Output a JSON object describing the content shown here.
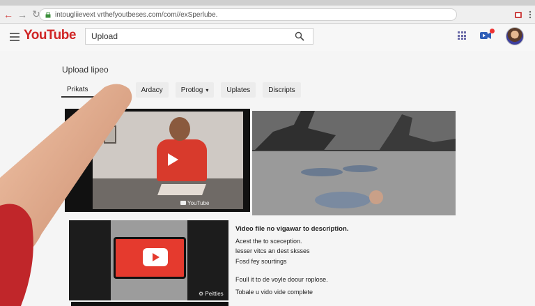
{
  "browser": {
    "url": "intougliievext vrthefyoutbeses.com/com//exSperlube."
  },
  "youtube": {
    "logo": "YouTube",
    "search_value": "Upload"
  },
  "page": {
    "title": "Upload lipeo",
    "tabs": [
      {
        "label": "Prikats",
        "active": true
      },
      {
        "label": "Ardacy"
      },
      {
        "label": "Protlog"
      },
      {
        "label": "Uplates"
      },
      {
        "label": "Discripts"
      }
    ]
  },
  "thumbnails": {
    "first_watermark": "YouTube",
    "third_watermark": "Peitties"
  },
  "description": {
    "heading": "Video file no vigawar to description.",
    "lines": [
      "Acest the to sceception.",
      "lesser vitcs an dest sksses",
      "Fosd fey sourtings",
      "Foull it to de voyle doour roplose.",
      "Tobale u vido vide complete"
    ]
  }
}
